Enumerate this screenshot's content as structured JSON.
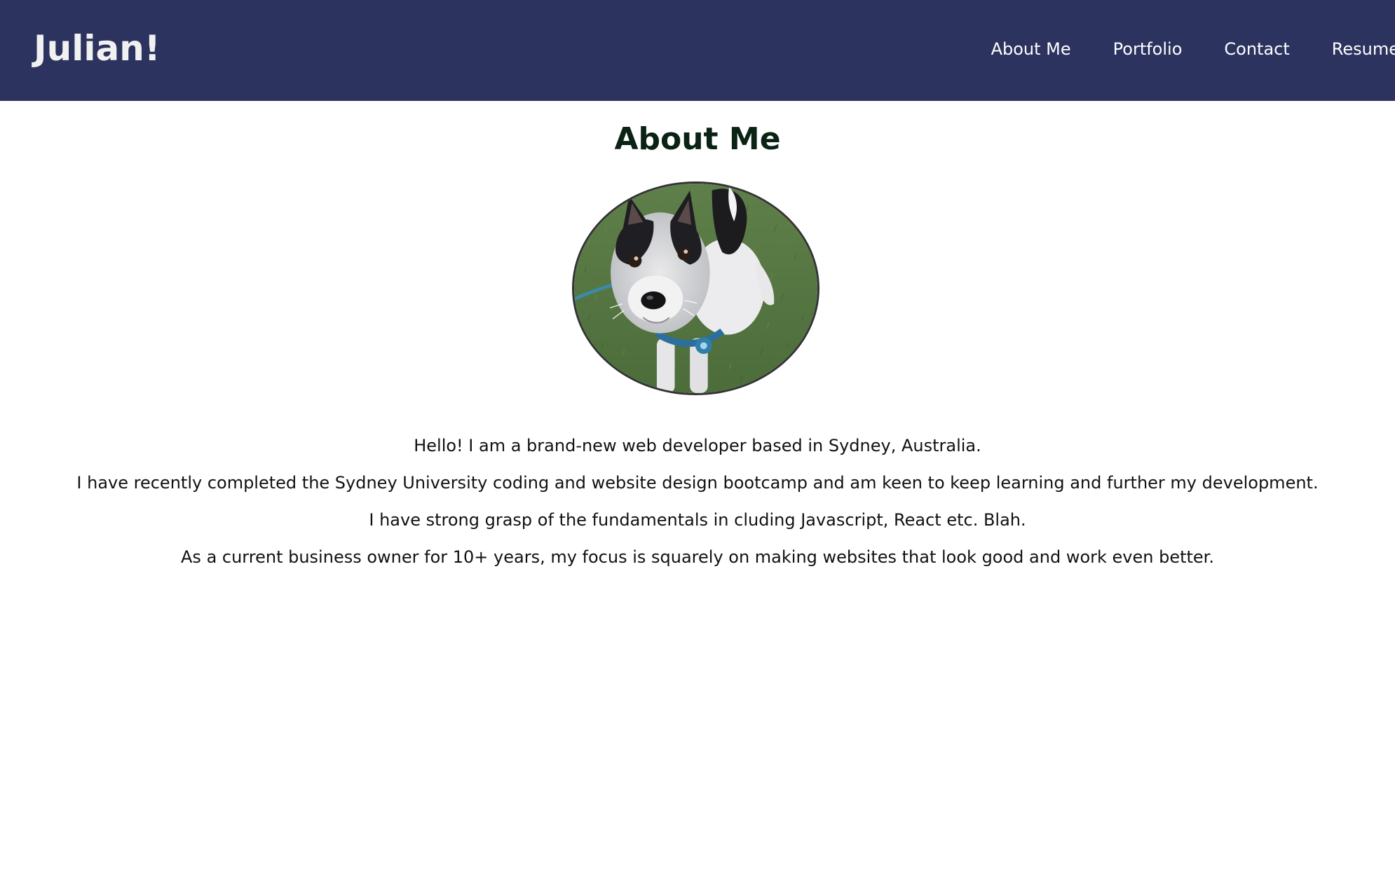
{
  "header": {
    "brand": "Julian!",
    "nav": [
      {
        "label": "About Me"
      },
      {
        "label": "Portfolio"
      },
      {
        "label": "Contact"
      },
      {
        "label": "Resume"
      }
    ]
  },
  "main": {
    "title": "About Me",
    "bio": [
      "Hello! I am a brand-new web developer based in Sydney, Australia.",
      "I have recently completed the Sydney University coding and website design bootcamp and am keen to keep learning and further my development.",
      "I have strong grasp of the fundamentals in cluding Javascript, React etc. Blah.",
      "As a current business owner for 10+ years, my focus is squarely on making websites that look good and work even better."
    ]
  },
  "colors": {
    "navbar_bg": "#2b335e",
    "nav_text": "#ffffff",
    "title_text": "#0a2314"
  }
}
